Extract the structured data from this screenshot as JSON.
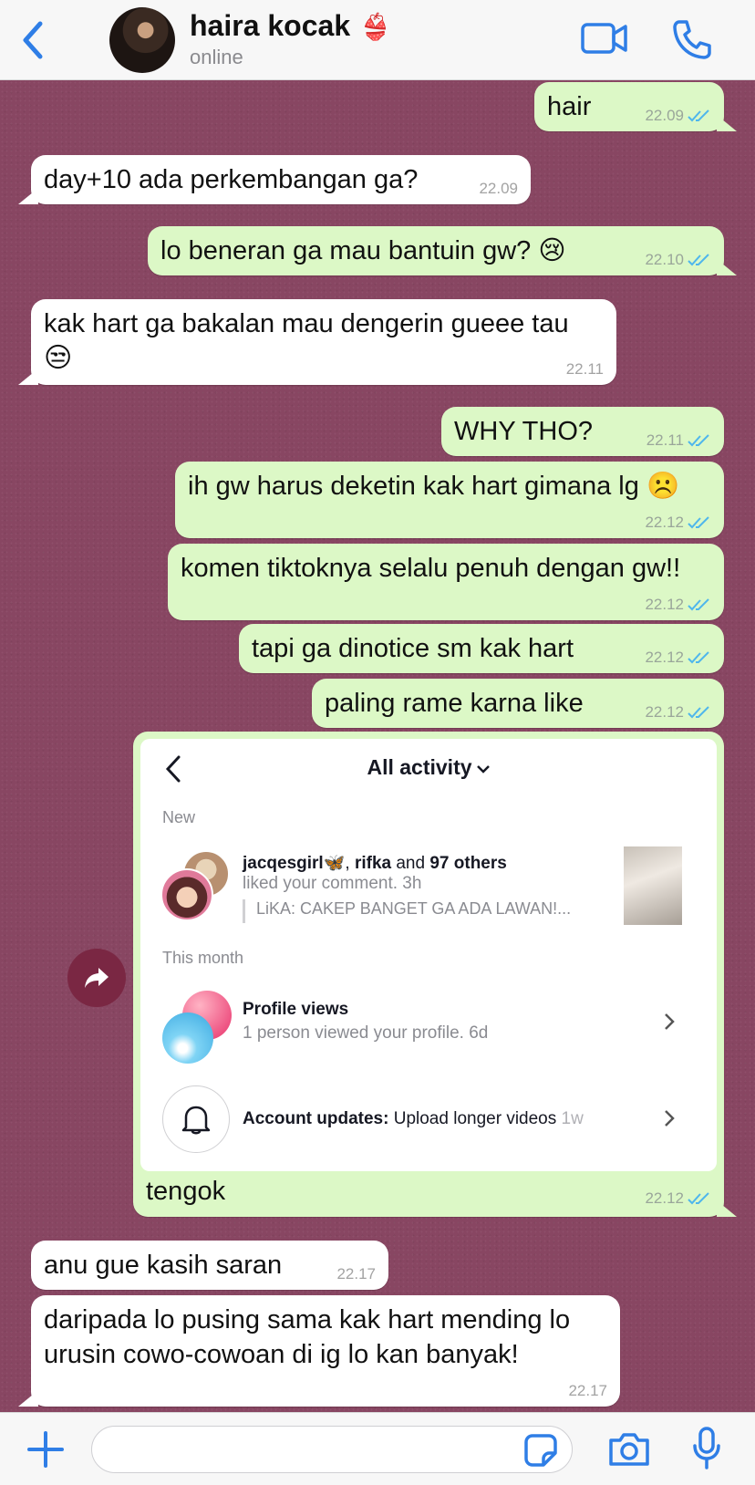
{
  "header": {
    "contact_name": "haira kocak",
    "name_emoji": "👙",
    "status": "online"
  },
  "messages": [
    {
      "dir": "out",
      "text": "hair",
      "time": "22.09",
      "read": true
    },
    {
      "dir": "in",
      "text": "day+10 ada perkembangan ga?",
      "time": "22.09"
    },
    {
      "dir": "out",
      "text": "lo beneran ga mau bantuin gw? 😢",
      "time": "22.10",
      "read": true
    },
    {
      "dir": "in",
      "text": "kak hart ga bakalan mau dengerin gueee tau",
      "emoji": "😒",
      "time": "22.11"
    },
    {
      "dir": "out",
      "text": "WHY THO?",
      "time": "22.11",
      "read": true
    },
    {
      "dir": "out",
      "text": "ih gw harus deketin kak hart gimana lg ☹️",
      "time": "22.12",
      "read": true
    },
    {
      "dir": "out",
      "text": "komen tiktoknya selalu penuh dengan gw!!",
      "time": "22.12",
      "read": true
    },
    {
      "dir": "out",
      "text": "tapi ga dinotice sm kak hart",
      "time": "22.12",
      "read": true
    },
    {
      "dir": "out",
      "text": "paling rame karna like",
      "time": "22.12",
      "read": true
    },
    {
      "dir": "in",
      "text": "anu gue kasih saran",
      "time": "22.17"
    },
    {
      "dir": "in",
      "text": "daripada lo pusing sama kak hart mending lo",
      "text2": "urusin cowo-cowoan di ig lo kan banyak!",
      "time": "22.17"
    }
  ],
  "image_message": {
    "caption": "tengok",
    "time": "22.12",
    "read": true,
    "screenshot": {
      "title": "All activity",
      "section_new": "New",
      "like_users": "jacqesgirl🦋",
      "like_sep": ", ",
      "like_user2": "rifka",
      "like_and": " and ",
      "like_others": "97 others",
      "like_action": "liked your comment. 3h",
      "like_quote": "LiKA: CAKEP BANGET GA ADA LAWAN!...",
      "section_month": "This month",
      "profile_views_title": "Profile views",
      "profile_views_sub": "1 person viewed your profile. 6d",
      "account_updates_label": "Account updates:",
      "account_updates_text": " Upload longer videos",
      "account_updates_time": " 1w"
    }
  },
  "composer": {
    "placeholder": ""
  },
  "colors": {
    "accent": "#2f7ee6",
    "outgoing_bubble": "#dcf8c6",
    "incoming_bubble": "#ffffff",
    "wallpaper": "#884662",
    "read_ticks": "#4fb6ec"
  }
}
